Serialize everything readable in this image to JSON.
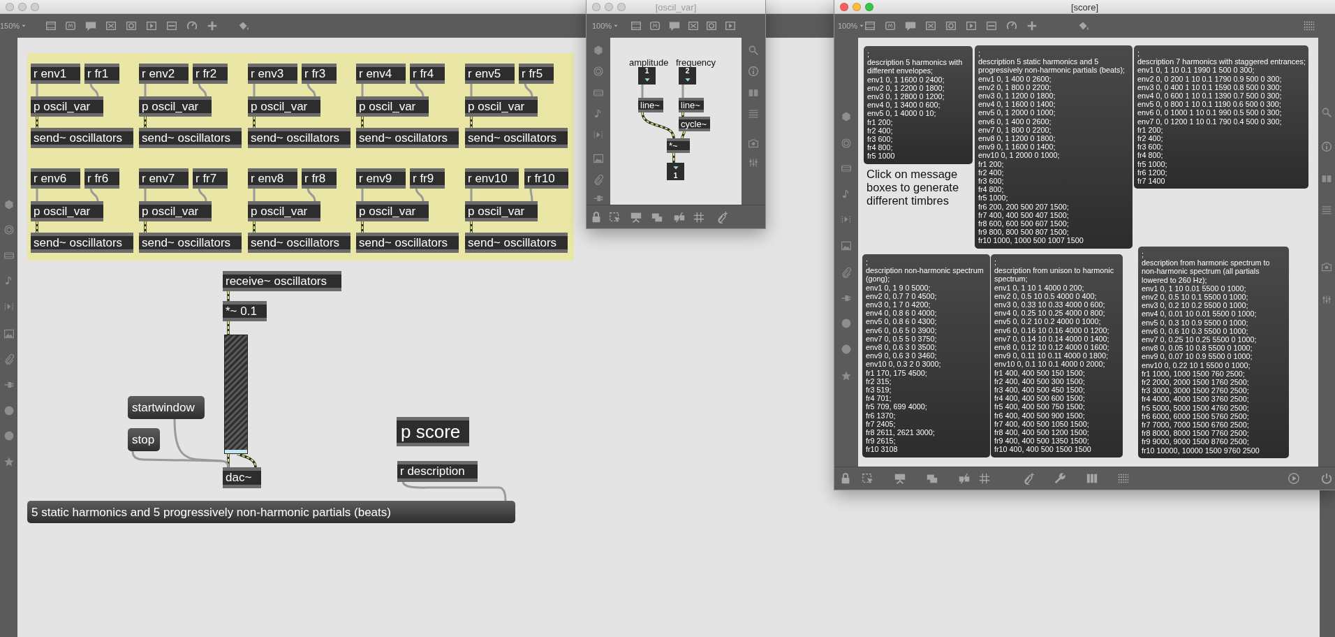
{
  "main_window": {
    "active": false,
    "zoom": "150%",
    "patch": {
      "modules": [
        {
          "env": "r env1",
          "fr": "r fr1",
          "osc": "p oscil_var",
          "send": "send~ oscillators"
        },
        {
          "env": "r env2",
          "fr": "r fr2",
          "osc": "p oscil_var",
          "send": "send~ oscillators"
        },
        {
          "env": "r env3",
          "fr": "r fr3",
          "osc": "p oscil_var",
          "send": "send~ oscillators"
        },
        {
          "env": "r env4",
          "fr": "r fr4",
          "osc": "p oscil_var",
          "send": "send~ oscillators"
        },
        {
          "env": "r env5",
          "fr": "r fr5",
          "osc": "p oscil_var",
          "send": "send~ oscillators"
        },
        {
          "env": "r env6",
          "fr": "r fr6",
          "osc": "p oscil_var",
          "send": "send~ oscillators"
        },
        {
          "env": "r env7",
          "fr": "r fr7",
          "osc": "p oscil_var",
          "send": "send~ oscillators"
        },
        {
          "env": "r env8",
          "fr": "r fr8",
          "osc": "p oscil_var",
          "send": "send~ oscillators"
        },
        {
          "env": "r env9",
          "fr": "r fr9",
          "osc": "p oscil_var",
          "send": "send~ oscillators"
        },
        {
          "env": "r env10",
          "fr": "r fr10",
          "osc": "p oscil_var",
          "send": "send~ oscillators"
        }
      ],
      "receive": "receive~ oscillators",
      "multiply": "*~ 0.1",
      "gain_slider": {
        "level": 0
      },
      "dac": "dac~",
      "messages": [
        "startwindow",
        "stop"
      ],
      "subpatch": "p score",
      "receive_description": "r description",
      "description_message": "5 static harmonics and 5 progressively non-harmonic partials (beats)"
    }
  },
  "oscil_var_window": {
    "title": "[oscil_var]",
    "active": false,
    "zoom": "100%",
    "patch": {
      "comments": [
        "amplitude",
        "frequency"
      ],
      "inlets": [
        "1",
        "2"
      ],
      "objects": [
        "line~",
        "line~",
        "cycle~",
        "*~"
      ],
      "outlet": "1"
    }
  },
  "score_window": {
    "title": "[score]",
    "active": true,
    "zoom": "100%",
    "patch": {
      "messages": [
        ";\ndescription 5 harmonics with different envelopes;\nenv1 0, 1 1600 0 2400;\nenv2 0, 1 2200 0 1800;\nenv3 0, 1 2800 0 1200;\nenv4 0, 1 3400 0 600;\nenv5 0, 1 4000 0 10;\nfr1 200;\nfr2 400;\nfr3 600;\nfr4 800;\nfr5 1000",
        ";\ndescription 5 static harmonics and 5 progressively non-harmonic partials (beats);\nenv1 0, 1 400 0 2600;\nenv2 0, 1 800 0 2200;\nenv3 0, 1 1200 0 1800;\nenv4 0, 1 1600 0 1400;\nenv5 0, 1 2000 0 1000;\nenv6 0, 1 400 0 2600;\nenv7 0, 1 800 0 2200;\nenv8 0, 1 1200 0 1800;\nenv9 0, 1 1600 0 1400;\nenv10 0, 1 2000 0 1000;\nfr1 200;\nfr2 400;\nfr3 600;\nfr4 800;\nfr5 1000;\nfr6 200, 200 500 207 1500;\nfr7 400, 400 500 407 1500;\nfr8 600, 600 500 607 1500;\nfr9 800, 800 500 807 1500;\nfr10 1000, 1000 500 1007 1500",
        ";\ndescription 7 harmonics with staggered entrances;\nenv1 0, 1 10 0.1 1990 1 500 0 300;\nenv2 0, 0 200 1 10 0.1 1790 0.9 500 0 300;\nenv3 0, 0 400 1 10 0.1 1590 0.8 500 0 300;\nenv4 0, 0 600 1 10 0.1 1390 0.7 500 0 300;\nenv5 0, 0 800 1 10 0.1 1190 0.6 500 0 300;\nenv6 0, 0 1000 1 10 0.1 990 0.5 500 0 300;\nenv7 0, 0 1200 1 10 0.1 790 0.4 500 0 300;\nfr1 200;\nfr2 400;\nfr3 600;\nfr4 800;\nfr5 1000;\nfr6 1200;\nfr7 1400",
        ";\ndescription non-harmonic spectrum (gong);\nenv1 0, 1 9 0 5000;\nenv2 0, 0.7 7 0 4500;\nenv3 0, 1 7 0 4200;\nenv4 0, 0.8 6 0 4000;\nenv5 0, 0.8 6 0 4300;\nenv6 0, 0.6 5 0 3900;\nenv7 0, 0.5 5 0 3750;\nenv8 0, 0.6 3 0 3500;\nenv9 0, 0.6 3 0 3460;\nenv10 0, 0.3 2 0 3000;\nfr1 170, 175 4500;\nfr2 315;\nfr3 519;\nfr4 701;\nfr5 709, 699 4000;\nfr6 1370;\nfr7 2405;\nfr8 2611, 2621 3000;\nfr9 2615;\nfr10 3108",
        ";\ndescription from unison to harmonic spectrum;\nenv1 0, 1 10 1 4000 0 200;\nenv2 0, 0.5 10 0.5 4000 0 400;\nenv3 0, 0.33 10 0.33 4000 0 600;\nenv4 0, 0.25 10 0.25 4000 0 800;\nenv5 0, 0.2 10 0.2 4000 0 1000;\nenv6 0, 0.16 10 0.16 4000 0 1200;\nenv7 0, 0.14 10 0.14 4000 0 1400;\nenv8 0, 0.12 10 0.12 4000 0 1600;\nenv9 0, 0.11 10 0.11 4000 0 1800;\nenv10 0, 0.1 10 0.1 4000 0 2000;\nfr1 400, 400 500 150 1500;\nfr2 400, 400 500 300 1500;\nfr3 400, 400 500 450 1500;\nfr4 400, 400 500 600 1500;\nfr5 400, 400 500 750 1500;\nfr6 400, 400 500 900 1500;\nfr7 400, 400 500 1050 1500;\nfr8 400, 400 500 1200 1500;\nfr9 400, 400 500 1350 1500;\nfr10 400, 400 500 1500 1500",
        ";\ndescription from harmonic spectrum to non-harmonic spectrum (all partials lowered to 260 Hz);\nenv1 0, 1 10 0.01 5500 0 1000;\nenv2 0, 0.5 10 0.1 5500 0 1000;\nenv3 0, 0.2 10 0.2 5500 0 1000;\nenv4 0, 0.01 10 0.01 5500 0 1000;\nenv5 0, 0.3 10 0.9 5500 0 1000;\nenv6 0, 0.6 10 0.3 5500 0 1000;\nenv7 0, 0.25 10 0.25 5500 0 1000;\nenv8 0, 0.05 10 0.8 5500 0 1000;\nenv9 0, 0.07 10 0.9 5500 0 1000;\nenv10 0, 0.22 10 1 5500 0 1000;\nfr1 1000, 1000 1500 760 2500;\nfr2 2000, 2000 1500 1760 2500;\nfr3 3000, 3000 1500 2760 2500;\nfr4 4000, 4000 1500 3760 2500;\nfr5 5000, 5000 1500 4760 2500;\nfr6 6000, 6000 1500 5760 2500;\nfr7 7000, 7000 1500 6760 2500;\nfr8 8000, 8000 1500 7760 2500;\nfr9 9000, 9000 1500 8760 2500;\nfr10 10000, 10000 1500 9760 2500"
      ],
      "comment": "Click on message boxes to generate different timbres"
    }
  }
}
